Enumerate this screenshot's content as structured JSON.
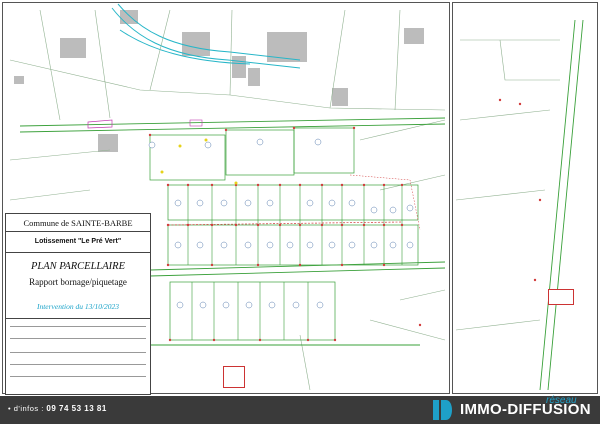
{
  "cartouche": {
    "commune": "Commune de SAINTE-BARBE",
    "lotissement": "Lotissement \"Le Pré Vert\"",
    "plan_title": "PLAN PARCELLAIRE",
    "subtitle": "Rapport bornage/piquetage",
    "intervention": "Intervention du 13/10/2023"
  },
  "footer": {
    "infos_label": "• d'infos :",
    "phone": "09 74 53 13 81",
    "brand": "IMMO-DIFFUSION",
    "reseau": "réseau"
  },
  "colors": {
    "footer_bg": "#3a3a3a",
    "accent": "#1ea0c8",
    "parcel_lines": "#3aa03a",
    "cadastre": "#7a9a7a",
    "markers": "#d23b3b"
  },
  "icons": {
    "logo": "logo-mark-icon"
  }
}
